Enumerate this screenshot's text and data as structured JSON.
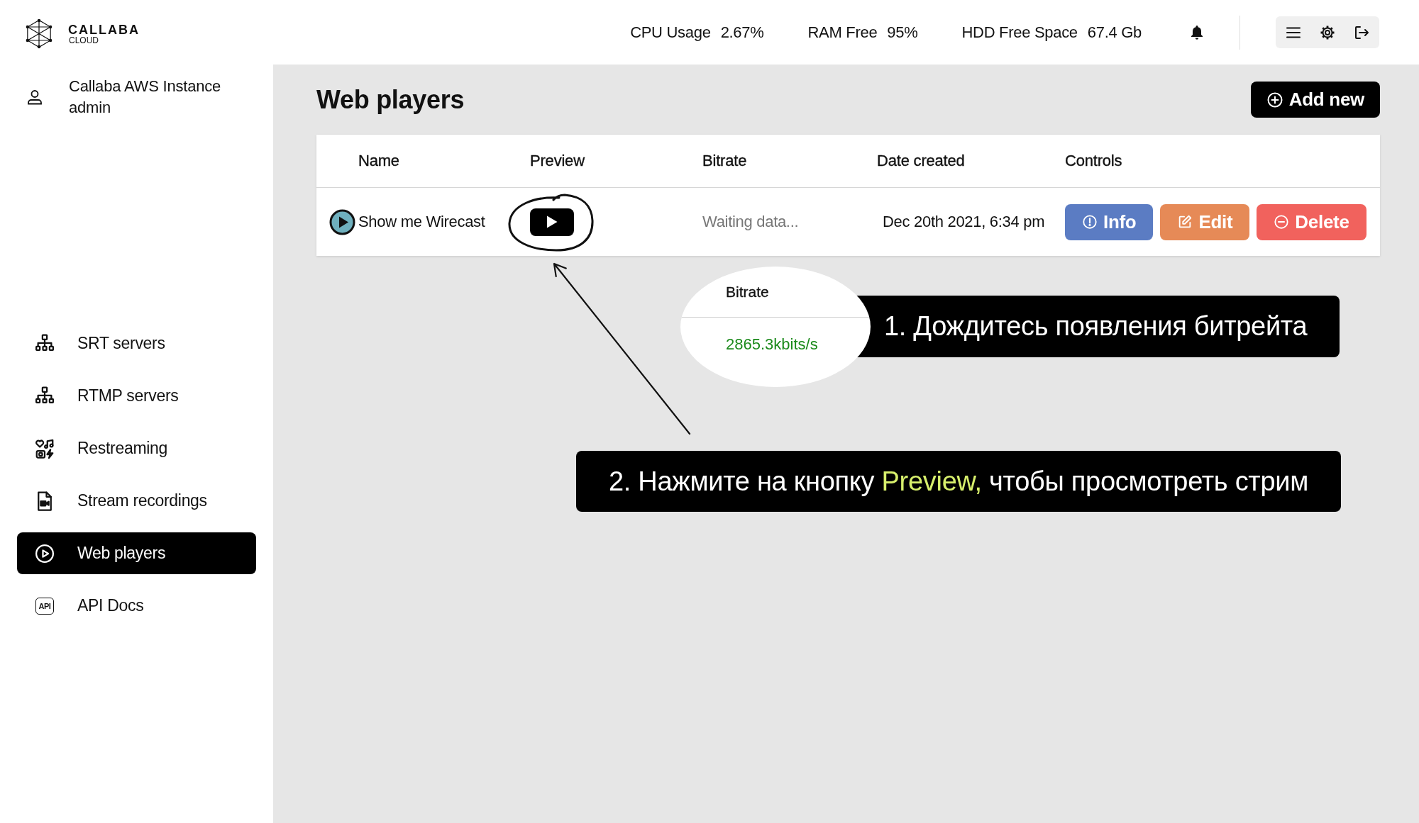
{
  "sidebar": {
    "logo": {
      "name": "CALLABA",
      "tagline": "CLOUD"
    },
    "account": {
      "instance": "Callaba AWS Instance",
      "user": "admin"
    },
    "nav": [
      {
        "label": "SRT servers",
        "selected": false
      },
      {
        "label": "RTMP servers",
        "selected": false
      },
      {
        "label": "Restreaming",
        "selected": false
      },
      {
        "label": "Stream recordings",
        "selected": false
      },
      {
        "label": "Web players",
        "selected": true
      },
      {
        "label": "API Docs",
        "icon_label": "API",
        "selected": false
      }
    ]
  },
  "topbar": {
    "stats": [
      {
        "label": "CPU Usage",
        "value": "2.67%"
      },
      {
        "label": "RAM Free",
        "value": "95%"
      },
      {
        "label": "HDD Free Space",
        "value": "67.4 Gb"
      }
    ]
  },
  "page": {
    "title": "Web players",
    "add_button": "Add new"
  },
  "table": {
    "columns": [
      "Name",
      "Preview",
      "Bitrate",
      "Date created",
      "Controls"
    ],
    "rows": [
      {
        "name": "Show me Wirecast",
        "bitrate": "Waiting data...",
        "date_created": "Dec 20th 2021, 6:34 pm",
        "controls": [
          {
            "kind": "info",
            "label": "Info"
          },
          {
            "kind": "edit",
            "label": "Edit"
          },
          {
            "kind": "delete",
            "label": "Delete"
          }
        ]
      }
    ]
  },
  "annotations": {
    "bubble": {
      "header": "Bitrate",
      "value": "2865.3kbits/s"
    },
    "callouts": [
      {
        "parts": [
          {
            "text": "1. Дождитесь появления битрейта",
            "highlight": false
          }
        ]
      },
      {
        "parts": [
          {
            "text": "2. Нажмите на кнопку",
            "highlight": false
          },
          {
            "text": "Preview,",
            "highlight": true
          },
          {
            "text": "чтобы просмотреть стрим",
            "highlight": false
          }
        ]
      }
    ]
  }
}
